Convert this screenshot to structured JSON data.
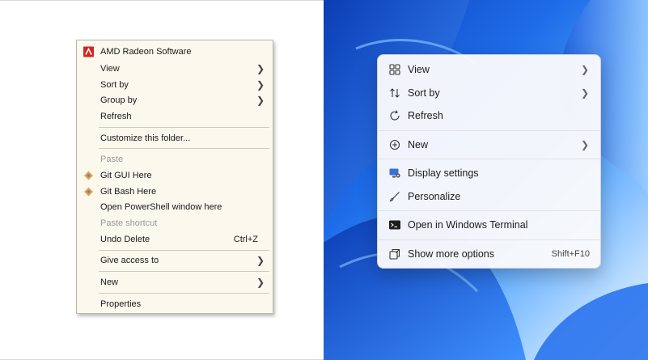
{
  "classic_menu": {
    "header": "AMD Radeon Software",
    "view": "View",
    "sort_by": "Sort by",
    "group_by": "Group by",
    "refresh": "Refresh",
    "customize": "Customize this folder...",
    "paste": "Paste",
    "git_gui": "Git GUI Here",
    "git_bash": "Git Bash Here",
    "powershell": "Open PowerShell window here",
    "paste_shortcut": "Paste shortcut",
    "undo_delete": "Undo Delete",
    "undo_shortcut": "Ctrl+Z",
    "give_access": "Give access to",
    "new": "New",
    "properties": "Properties"
  },
  "modern_menu": {
    "view": "View",
    "sort_by": "Sort by",
    "refresh": "Refresh",
    "new": "New",
    "display_settings": "Display settings",
    "personalize": "Personalize",
    "terminal": "Open in Windows Terminal",
    "more_options": "Show more options",
    "more_options_shortcut": "Shift+F10"
  },
  "colors": {
    "amd_red": "#d0281f",
    "menu_bg_classic": "#fbf8ee",
    "wallpaper_blue": "#1f6dea"
  },
  "icons": {
    "amd": "amd-radeon-icon",
    "git": "git-diamond-icon",
    "view": "grid-view-icon",
    "sort": "sort-arrows-icon",
    "refresh": "refresh-icon",
    "new": "plus-circle-icon",
    "display": "display-settings-icon",
    "personalize": "brush-icon",
    "terminal": "terminal-icon",
    "more": "more-options-icon",
    "submenu": "chevron-right-icon"
  }
}
